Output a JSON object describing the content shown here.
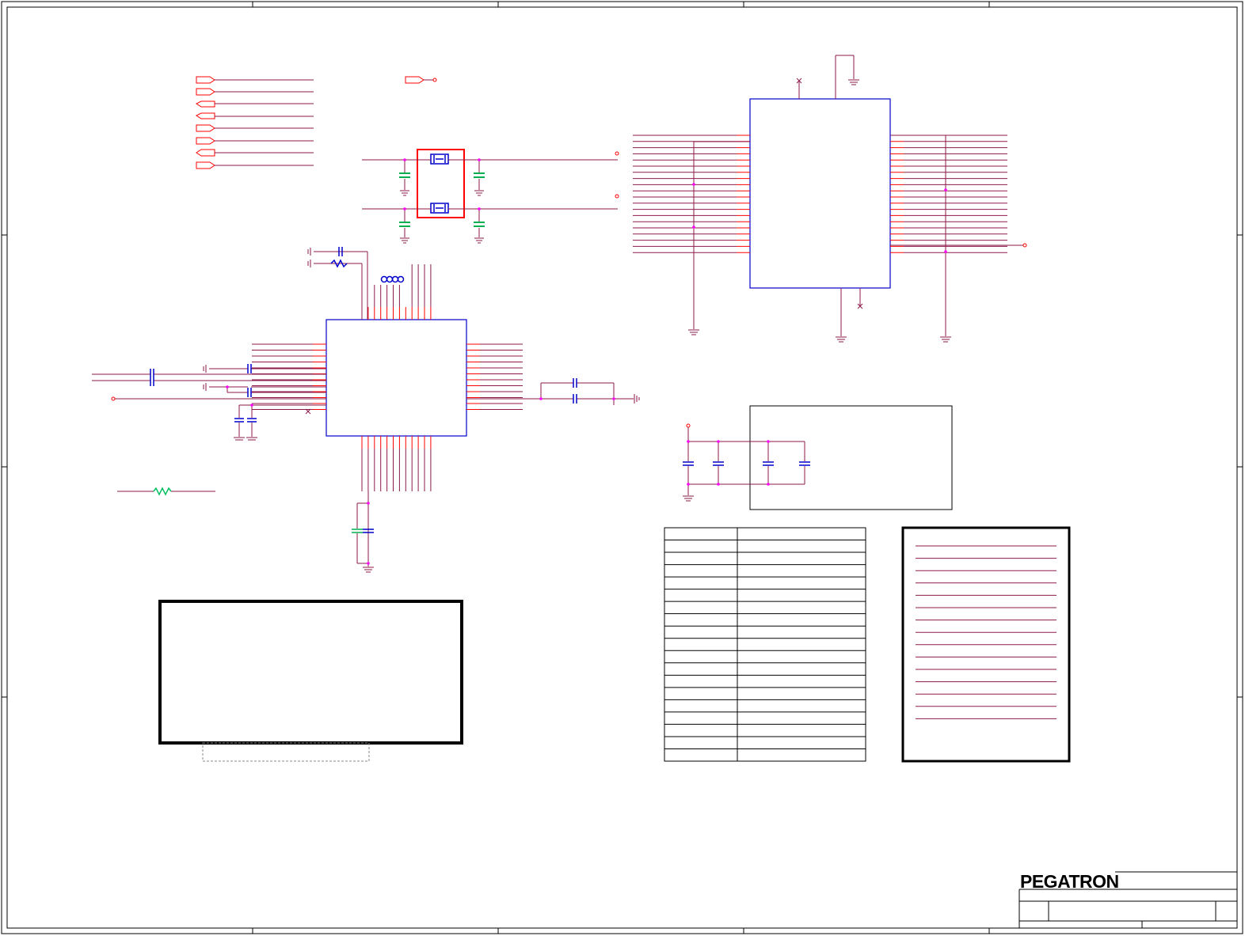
{
  "title_block": {
    "company_logo": "PEGATRON"
  },
  "colors": {
    "frame": "#000000",
    "wire": "#8b1a4a",
    "pin": "#ff0000",
    "component": "#0000cc",
    "highlight_box": "#ff0000",
    "capacitor_alt": "#00b050",
    "junction": "#ff00ff",
    "resistor_alt": "#00c060"
  },
  "components": {
    "u_top_right": "ic-body",
    "u_center_left": "ic-body",
    "crystal_pair": "crystal-pair"
  },
  "tables": {
    "strap_table_rows": 19,
    "note_box_lines": 15
  }
}
